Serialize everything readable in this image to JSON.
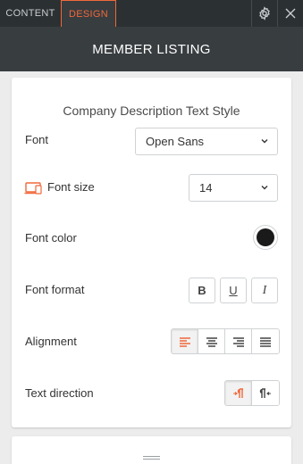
{
  "tabs": {
    "content": "CONTENT",
    "design": "DESIGN"
  },
  "header": {
    "title": "MEMBER LISTING"
  },
  "section": {
    "title": "Company Description Text Style"
  },
  "font": {
    "label": "Font",
    "value": "Open Sans"
  },
  "font_size": {
    "label": "Font size",
    "value": "14"
  },
  "font_color": {
    "label": "Font color",
    "color": "#1a1a1a"
  },
  "font_format": {
    "label": "Font format",
    "bold": "B",
    "underline": "U",
    "italic": "I"
  },
  "alignment": {
    "label": "Alignment",
    "options": [
      "align-left",
      "align-center",
      "align-right",
      "justify"
    ],
    "selected": "align-left"
  },
  "text_direction": {
    "label": "Text direction",
    "options": [
      "ltr",
      "rtl"
    ],
    "selected": "ltr"
  },
  "colors": {
    "accent": "#f0683a",
    "topbar": "#2b3033",
    "header": "#383d40"
  }
}
